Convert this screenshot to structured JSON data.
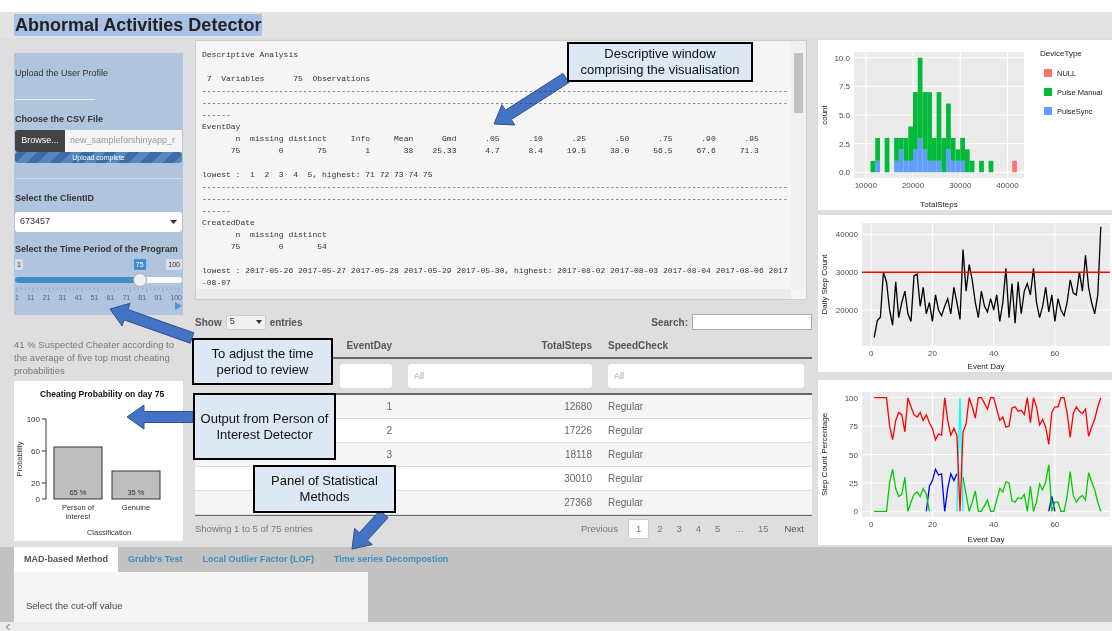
{
  "title": "Abnormal Activities Detector",
  "sidebar": {
    "upload_heading": "Upload the User Profile",
    "file_label": "Choose the CSV File",
    "browse_button": "Browse...",
    "file_name": "new_sampleforshinyapp_r",
    "upload_status": "Upload complete",
    "upload_progress": {
      "level": 1
    },
    "client_label": "Select the ClientID",
    "client_value": "673457",
    "period_label": "Select the Time Period of the Program",
    "period_slider": {
      "min_label": "1",
      "value_label": "75",
      "max_label": "100",
      "level": 0.747,
      "grid_labels": [
        "1",
        "11",
        "21",
        "31",
        "41",
        "51",
        "61",
        "71",
        "81",
        "91",
        "100"
      ]
    }
  },
  "suspect_text": "41 % Suspected Cheater according to the average of five top most cheating probabilities",
  "probability_chart": {
    "chart_data": {
      "type": "bar",
      "title": "Cheating Probability on day 75",
      "xlabel": "Classification",
      "ylabel": "Probability",
      "categories": [
        "Person of interest",
        "Genuine"
      ],
      "values": [
        65,
        35
      ],
      "ylim": [
        0,
        100
      ],
      "yticks": [
        {
          "value": 0,
          "label": "0"
        },
        {
          "value": 20,
          "label": "20"
        },
        {
          "value": 60,
          "label": "60"
        },
        {
          "value": 100,
          "label": "100"
        }
      ],
      "value_labels": [
        "65 %",
        "35 %"
      ]
    }
  },
  "output_text": "Descriptive Analysis\n\n 7  Variables      75  Observations\n--------------------------------------------------------------------------------------------------------------------------\n--------------------------------------------------------------------------------------------------------------------------\n------\nEventDay\n       n  missing distinct     Info     Mean      Gmd      .05      .10      .25      .50      .75      .90      .95\n      75        0       75        1       38    25.33      4.7      8.4     19.5     38.0     56.5     67.6     71.3\n\nlowest :  1  2  3  4  5, highest: 71 72 73 74 75\n--------------------------------------------------------------------------------------------------------------------------\n--------------------------------------------------------------------------------------------------------------------------\n------\nCreatedDate\n       n  missing distinct\n      75        0       54\n\nlowest : 2017-05-26 2017-05-27 2017-05-28 2017-05-29 2017-05-30, highest: 2017-08-02 2017-08-03 2017-08-04 2017-08-06 2017\n-08-07",
  "table": {
    "show_label": "Show",
    "length_value": "5",
    "entries_label": "entries",
    "search_label": "Search:",
    "columns": [
      {
        "header": "EventDay"
      },
      {
        "header": "TotalSteps",
        "filter_placeholder": "All"
      },
      {
        "header": "SpeedCheck",
        "filter_placeholder": "All"
      }
    ],
    "rows": [
      {
        "event_day": "1",
        "total_steps": "12680",
        "speed_check": "Regular"
      },
      {
        "event_day": "2",
        "total_steps": "17226",
        "speed_check": "Regular"
      },
      {
        "event_day": "3",
        "total_steps": "18118",
        "speed_check": "Regular"
      },
      {
        "total_steps": "30010",
        "speed_check": "Regular"
      },
      {
        "total_steps": "27368",
        "speed_check": "Regular"
      }
    ],
    "info": "Showing 1 to 5 of 75 entries",
    "pagination": {
      "previous": "Previous",
      "next": "Next",
      "pages": [
        {
          "label": "1",
          "selected": true
        },
        {
          "label": "2",
          "selected": false
        },
        {
          "label": "3",
          "selected": false
        },
        {
          "label": "4",
          "selected": false
        },
        {
          "label": "5",
          "selected": false
        },
        {
          "label": "…",
          "selected": false
        },
        {
          "label": "15",
          "selected": false
        }
      ]
    }
  },
  "histogram": {
    "chart_data": {
      "type": "bar",
      "stacked": true,
      "grid": true,
      "legend": {
        "title": "DeviceType"
      },
      "xlabel": "TotalSteps",
      "ylabel": "count",
      "xlim": [
        7500,
        43500
      ],
      "ylim": [
        -0.5,
        10.5
      ],
      "xticks": [
        10000,
        20000,
        30000,
        40000
      ],
      "yticks": [
        {
          "value": 0,
          "label": "0.0"
        },
        {
          "value": 2.5,
          "label": "2.5"
        },
        {
          "value": 5,
          "label": "5.0"
        },
        {
          "value": 7.5,
          "label": "7.5"
        },
        {
          "value": 10,
          "label": "10.0"
        }
      ],
      "x": [
        11500,
        12500,
        13500,
        14500,
        15500,
        16500,
        17500,
        18500,
        19500,
        20500,
        21500,
        22500,
        23500,
        24500,
        25500,
        26500,
        27500,
        28500,
        29500,
        30500,
        31500,
        32500,
        33500,
        34500,
        35500,
        36500,
        37500,
        38500,
        39500,
        40500,
        41500
      ],
      "series": [
        {
          "name": "NULL",
          "color": "#f8766d",
          "values": [
            0,
            0,
            0,
            0,
            0,
            0,
            0,
            0,
            0,
            0,
            0,
            0,
            0,
            0,
            0,
            0,
            0,
            0,
            0,
            0,
            0,
            0,
            0,
            0,
            0,
            0,
            0,
            0,
            0,
            0,
            1
          ]
        },
        {
          "name": "Pulse Manual",
          "color": "#00ba38",
          "values": [
            1,
            2,
            0,
            3,
            0,
            2,
            1,
            2,
            3,
            5,
            7,
            5,
            6,
            2,
            6,
            3,
            4,
            2,
            1,
            2,
            2,
            1,
            0,
            1,
            0,
            1,
            0,
            0,
            0,
            0,
            0
          ]
        },
        {
          "name": "PulseSync",
          "color": "#619cff",
          "values": [
            0,
            1,
            0,
            0,
            0,
            1,
            2,
            1,
            1,
            2,
            3,
            2,
            1,
            1,
            1,
            0,
            2,
            1,
            1,
            1,
            0,
            0,
            0,
            0,
            0,
            0,
            0,
            0,
            0,
            0,
            0
          ]
        }
      ]
    }
  },
  "step_chart": {
    "chart_data": {
      "type": "line",
      "grid": true,
      "xlabel": "Event Day",
      "ylabel": "Daily Step Count",
      "xlim": [
        -3,
        78
      ],
      "ylim": [
        10500,
        43000
      ],
      "xticks": [
        0,
        20,
        40,
        60
      ],
      "yticks": [
        20000,
        30000,
        40000
      ],
      "x": [
        1,
        2,
        3,
        4,
        5,
        6,
        7,
        8,
        9,
        10,
        11,
        12,
        13,
        14,
        15,
        16,
        17,
        18,
        19,
        20,
        21,
        22,
        23,
        24,
        25,
        26,
        27,
        28,
        29,
        30,
        31,
        32,
        33,
        34,
        35,
        36,
        37,
        38,
        39,
        40,
        41,
        42,
        43,
        44,
        45,
        46,
        47,
        48,
        49,
        50,
        51,
        52,
        53,
        54,
        55,
        56,
        57,
        58,
        59,
        60,
        61,
        62,
        63,
        64,
        65,
        66,
        67,
        68,
        69,
        70,
        71,
        72,
        73,
        74,
        75
      ],
      "series": [
        {
          "color": "#000000",
          "values": [
            12700,
            17200,
            18100,
            30000,
            27400,
            20000,
            16000,
            27500,
            18000,
            22000,
            25000,
            19000,
            17000,
            29000,
            29500,
            21000,
            26000,
            19000,
            22000,
            17000,
            24000,
            20000,
            18500,
            21000,
            23000,
            19000,
            26000,
            22000,
            17500,
            36000,
            25000,
            32000,
            28000,
            22000,
            18000,
            25000,
            21000,
            19500,
            23000,
            20000,
            24000,
            17000,
            22000,
            31000,
            18000,
            27000,
            16500,
            27500,
            19000,
            25000,
            27000,
            24000,
            31000,
            22000,
            18000,
            21000,
            26000,
            19500,
            24000,
            17000,
            23000,
            20000,
            18500,
            22000,
            28000,
            24500,
            24000,
            30000,
            25000,
            34500,
            26000,
            22000,
            19000,
            24000,
            42000
          ]
        }
      ],
      "ref_lines": [
        {
          "axis": "y",
          "value": 30000
        }
      ]
    }
  },
  "percentage_chart": {
    "chart_data": {
      "type": "line",
      "grid": true,
      "xlabel": "Event Day",
      "ylabel": "Step Count Percentage",
      "xlim": [
        -3,
        78
      ],
      "ylim": [
        -5,
        105
      ],
      "xticks": [
        0,
        20,
        40,
        60
      ],
      "yticks": [
        {
          "value": 0,
          "label": "0"
        },
        {
          "value": 25,
          "label": "25"
        },
        {
          "value": 50,
          "label": "50"
        },
        {
          "value": 75,
          "label": "75"
        },
        {
          "value": 100,
          "label": "100"
        }
      ],
      "x": [
        1,
        2,
        3,
        4,
        5,
        6,
        7,
        8,
        9,
        10,
        11,
        12,
        13,
        14,
        15,
        16,
        17,
        18,
        19,
        20,
        21,
        22,
        23,
        24,
        25,
        26,
        27,
        28,
        29,
        30,
        31,
        32,
        33,
        34,
        35,
        36,
        37,
        38,
        39,
        40,
        41,
        42,
        43,
        44,
        45,
        46,
        47,
        48,
        49,
        50,
        51,
        52,
        53,
        54,
        55,
        56,
        57,
        58,
        59,
        60,
        61,
        62,
        63,
        64,
        65,
        66,
        67,
        68,
        69,
        70,
        71,
        72,
        73,
        74,
        75
      ],
      "series": [
        {
          "color": "#ff0000",
          "values": [
            100,
            100,
            100,
            100,
            100,
            75,
            63,
            80,
            87,
            85,
            70,
            100,
            92,
            85,
            83,
            87,
            80,
            85,
            78,
            73,
            63,
            68,
            67,
            100,
            80,
            67,
            73,
            67,
            0,
            70,
            77,
            100,
            92,
            82,
            100,
            100,
            95,
            90,
            100,
            100,
            90,
            80,
            83,
            74,
            75,
            91,
            92,
            88,
            89,
            85,
            100,
            78,
            100,
            92,
            76,
            81,
            74,
            59,
            87,
            92,
            92,
            100,
            100,
            87,
            65,
            86,
            92,
            88,
            86,
            90,
            66,
            74,
            81,
            92,
            100
          ]
        },
        {
          "color": "#00cc00",
          "values": [
            0,
            0,
            0,
            0,
            0,
            25,
            37,
            20,
            13,
            15,
            30,
            0,
            8,
            15,
            17,
            13,
            20,
            15,
            0,
            null,
            null,
            null,
            null,
            null,
            null,
            null,
            null,
            null,
            null,
            30,
            15,
            0,
            8,
            18,
            0,
            0,
            5,
            10,
            0,
            0,
            10,
            20,
            17,
            26,
            25,
            9,
            8,
            12,
            11,
            15,
            0,
            22,
            0,
            8,
            24,
            19,
            26,
            41,
            0,
            8,
            8,
            0,
            0,
            13,
            35,
            14,
            8,
            12,
            14,
            10,
            34,
            26,
            19,
            8,
            0
          ]
        },
        {
          "color": "#0000ff",
          "values": [
            null,
            null,
            null,
            null,
            null,
            null,
            null,
            null,
            null,
            null,
            null,
            null,
            null,
            null,
            null,
            null,
            null,
            0,
            22,
            27,
            37,
            32,
            33,
            0,
            20,
            33,
            27,
            33,
            null,
            null,
            null,
            null,
            null,
            null,
            null,
            null,
            null,
            null,
            null,
            null,
            null,
            null,
            null,
            null,
            null,
            null,
            null,
            null,
            null,
            null,
            null,
            null,
            null,
            null,
            null,
            null,
            null,
            0,
            13,
            0,
            null,
            null,
            null,
            null,
            null,
            null,
            null,
            null,
            null,
            null,
            null,
            null,
            null,
            null,
            null
          ]
        },
        {
          "color": "#00ffff",
          "values": [
            null,
            null,
            null,
            null,
            null,
            null,
            null,
            null,
            null,
            null,
            null,
            null,
            null,
            null,
            null,
            null,
            null,
            null,
            null,
            null,
            null,
            null,
            null,
            null,
            null,
            null,
            null,
            0,
            100,
            0,
            null,
            null,
            null,
            null,
            null,
            null,
            null,
            null,
            null,
            null,
            null,
            null,
            null,
            null,
            null,
            null,
            null,
            null,
            null,
            null,
            null,
            null,
            null,
            null,
            null,
            null,
            null,
            null,
            null,
            null,
            null,
            null,
            null,
            null,
            null,
            null,
            null,
            null,
            null,
            null,
            null,
            null,
            null,
            null,
            null
          ]
        }
      ]
    }
  },
  "method_tabs": [
    {
      "label": "MAD-based Method",
      "selected": true
    },
    {
      "label": "Grubb's Test",
      "selected": false
    },
    {
      "label": "Local Outlier Factor (LOF)",
      "selected": false
    },
    {
      "label": "Time series Decompostion",
      "selected": false
    }
  ],
  "tab_panel": {
    "label": "Select the cut-off value"
  },
  "callouts": [
    {
      "text": "Descriptive window comprising the visualisation"
    },
    {
      "text": "To adjust the time period to review"
    },
    {
      "text": "Output from Person of Interest Detector"
    },
    {
      "text": "Panel of Statistical Methods"
    }
  ]
}
